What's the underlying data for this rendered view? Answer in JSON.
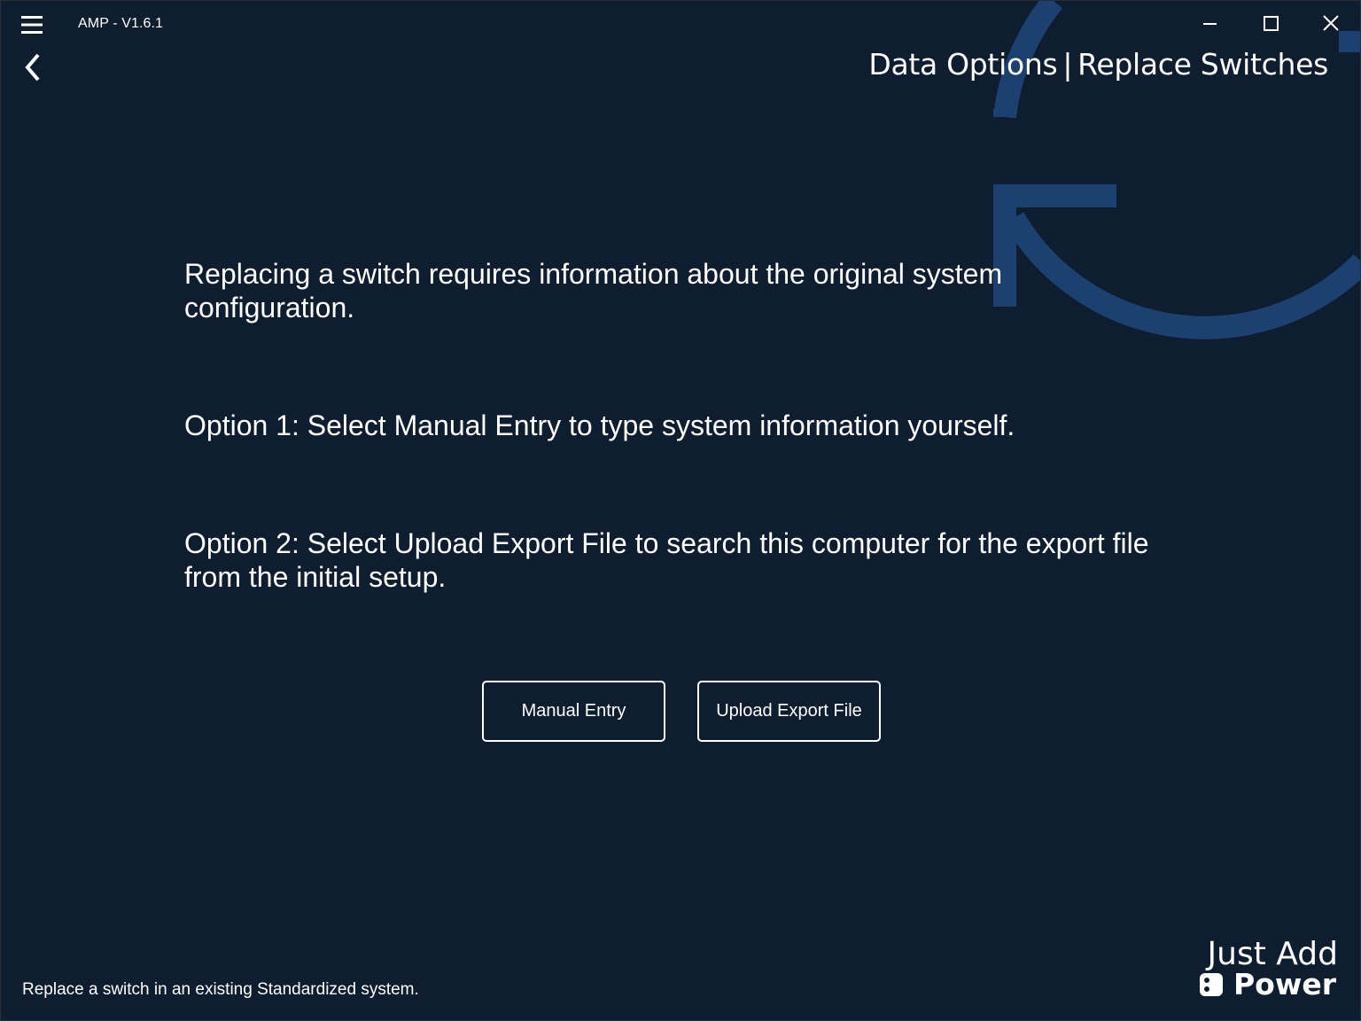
{
  "window": {
    "app_title": "AMP - V1.6.1",
    "controls": {
      "minimize": "minimize-icon",
      "maximize": "maximize-icon",
      "close": "close-icon"
    }
  },
  "header": {
    "menu_icon": "hamburger-menu-icon",
    "back_icon": "chevron-left-icon",
    "title_section": "Data Options",
    "title_separator": "|",
    "title_page": "Replace Switches"
  },
  "main": {
    "paragraphs": [
      "Replacing a switch requires information about the original system configuration.",
      "Option 1: Select Manual Entry to type system information yourself.",
      "Option 2: Select Upload Export File to search this computer for the export file from the initial setup."
    ],
    "buttons": {
      "manual_entry": "Manual Entry",
      "upload_export_file": "Upload Export File"
    }
  },
  "footer": {
    "description": "Replace a switch in an existing Standardized system.",
    "brand_line1": "Just Add",
    "brand_line2": "Power"
  },
  "colors": {
    "background": "#0e1d30",
    "accent_graphic": "#1c4170",
    "text": "#ffffff"
  }
}
